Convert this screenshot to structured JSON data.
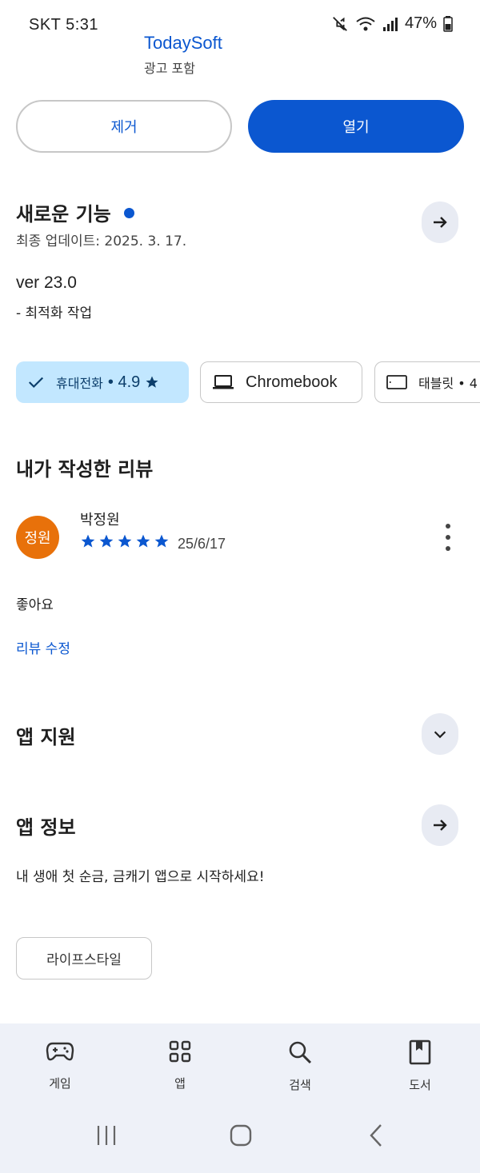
{
  "status_bar": {
    "carrier_time": "SKT 5:31",
    "battery": "47%"
  },
  "header": {
    "developer": "TodaySoft",
    "ads_note": "광고 포함"
  },
  "actions": {
    "uninstall_label": "제거",
    "open_label": "열기"
  },
  "whats_new": {
    "title": "새로운 기능",
    "last_updated": "최종 업데이트: 2025. 3. 17.",
    "version": "ver 23.0",
    "note": "- 최적화 작업"
  },
  "devices": {
    "phone_label": "휴대전화",
    "phone_rating": "• 4.9",
    "chromebook_label": "Chromebook",
    "tablet_label": "태블릿 • 4"
  },
  "my_review": {
    "title": "내가 작성한 리뷰",
    "avatar_text": "정원",
    "reviewer": "박정원",
    "rating": 5,
    "date": "25/6/17",
    "text": "좋아요",
    "edit_label": "리뷰 수정"
  },
  "app_support": {
    "title": "앱 지원"
  },
  "about": {
    "title": "앱 정보",
    "description": "내 생애 첫 순금, 금캐기 앱으로 시작하세요!",
    "category": "라이프스타일"
  },
  "bottom_nav": {
    "items": [
      {
        "label": "게임",
        "icon": "gamepad-icon"
      },
      {
        "label": "앱",
        "icon": "apps-grid-icon"
      },
      {
        "label": "검색",
        "icon": "search-icon"
      },
      {
        "label": "도서",
        "icon": "book-icon"
      }
    ]
  },
  "colors": {
    "accent": "#0b57d0",
    "chip_selected": "#c2e7ff",
    "avatar": "#e8710a",
    "nav_bg": "#eef1f8"
  }
}
